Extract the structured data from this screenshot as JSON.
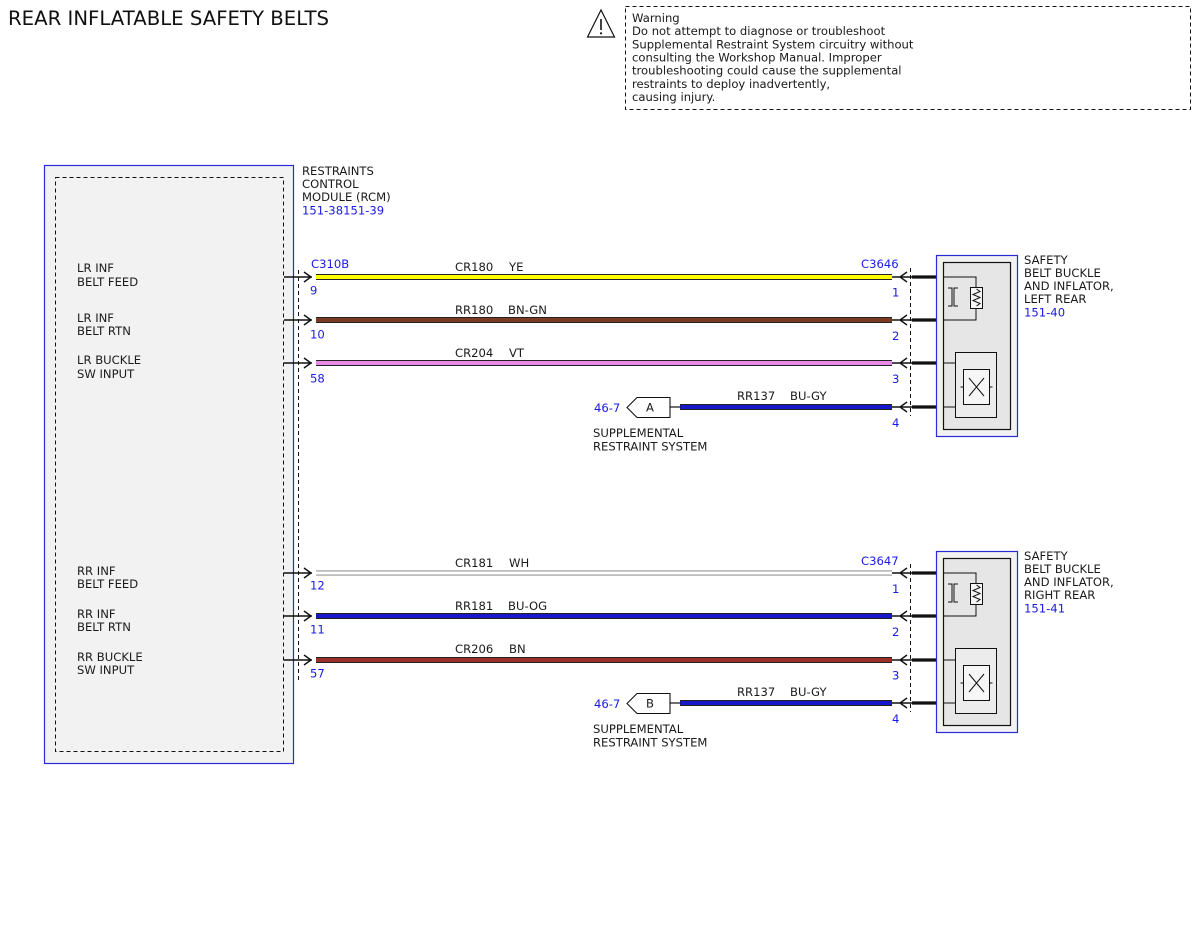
{
  "title": "REAR INFLATABLE SAFETY BELTS",
  "warning": {
    "icon": "warning-triangle-icon",
    "heading": "Warning",
    "lines": [
      "Do not attempt to diagnose or troubleshoot",
      "Supplemental Restraint System circuitry without",
      "consulting the Workshop Manual. Improper",
      "troubleshooting could cause the supplemental",
      "restraints to deploy inadvertently,",
      "causing injury."
    ]
  },
  "module": {
    "name": [
      "RESTRAINTS",
      "CONTROL",
      "MODULE (RCM)"
    ],
    "ref": "151-38151-39",
    "connector": "C310B",
    "pins": [
      {
        "label": [
          "LR INF",
          "BELT FEED"
        ],
        "pin": "9"
      },
      {
        "label": [
          "LR INF",
          "BELT RTN"
        ],
        "pin": "10"
      },
      {
        "label": [
          "LR BUCKLE",
          "SW INPUT"
        ],
        "pin": "58"
      },
      {
        "label": [
          "RR INF",
          "BELT FEED"
        ],
        "pin": "12"
      },
      {
        "label": [
          "RR INF",
          "BELT RTN"
        ],
        "pin": "11"
      },
      {
        "label": [
          "RR BUCKLE",
          "SW INPUT"
        ],
        "pin": "57"
      }
    ]
  },
  "circuits": [
    {
      "circuit": "CR180",
      "color_code": "YE",
      "wire_color": "#ffff00"
    },
    {
      "circuit": "RR180",
      "color_code": "BN-GN",
      "wire_color": "#7a3b22"
    },
    {
      "circuit": "CR204",
      "color_code": "VT",
      "wire_color": "#e68ae6"
    },
    {
      "circuit": "RR137",
      "color_code": "BU-GY",
      "wire_color": "#1818c8"
    },
    {
      "circuit": "CR181",
      "color_code": "WH",
      "wire_color": "#ffffff"
    },
    {
      "circuit": "RR181",
      "color_code": "BU-OG",
      "wire_color": "#1818c8"
    },
    {
      "circuit": "CR206",
      "color_code": "BN",
      "wire_color": "#9b2f28"
    },
    {
      "circuit": "RR137",
      "color_code": "BU-GY",
      "wire_color": "#1818c8"
    }
  ],
  "components": [
    {
      "name": [
        "SAFETY",
        "BELT BUCKLE",
        "AND INFLATOR,",
        "LEFT REAR"
      ],
      "ref": "151-40",
      "connector": "C3646",
      "pins": [
        "1",
        "2",
        "3",
        "4"
      ]
    },
    {
      "name": [
        "SAFETY",
        "BELT BUCKLE",
        "AND INFLATOR,",
        "RIGHT REAR"
      ],
      "ref": "151-41",
      "connector": "C3647",
      "pins": [
        "1",
        "2",
        "3",
        "4"
      ]
    }
  ],
  "off_page": [
    {
      "ref": "46-7",
      "letter": "A",
      "label": [
        "SUPPLEMENTAL",
        "RESTRAINT SYSTEM"
      ]
    },
    {
      "ref": "46-7",
      "letter": "B",
      "label": [
        "SUPPLEMENTAL",
        "RESTRAINT SYSTEM"
      ]
    }
  ],
  "colors": {
    "ref_blue": "#1a1ae6",
    "module_border": "#2a2ad6",
    "module_fill": "#f2f2f2",
    "component_fill": "#e6e6e6"
  }
}
